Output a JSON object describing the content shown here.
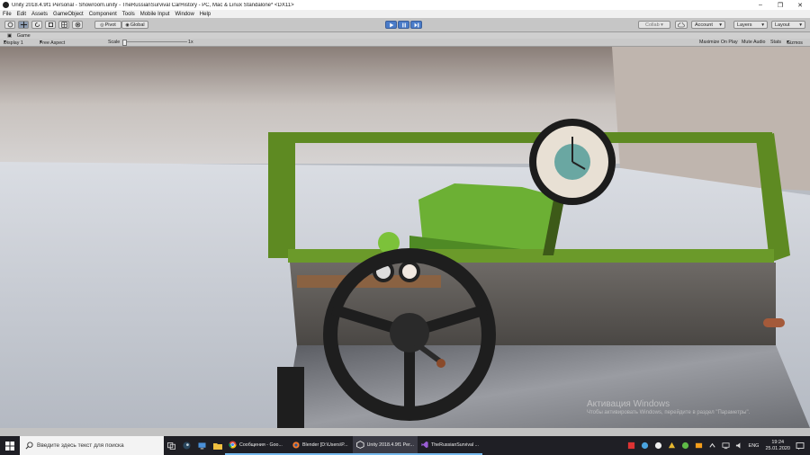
{
  "window": {
    "title": "Unity 2018.4.9f1 Personal - Showroom.unity - TheRussianSurvival CarHistory - PC, Mac & Linux Standalone* <DX11>"
  },
  "menu": [
    "File",
    "Edit",
    "Assets",
    "GameObject",
    "Component",
    "Tools",
    "Mobile Input",
    "Window",
    "Help"
  ],
  "toolbar": {
    "pivot": "Pivot",
    "global": "Global",
    "collab": "Collab ▾",
    "account": "Account",
    "layers": "Layers",
    "layout": "Layout"
  },
  "game_tab": "Game",
  "game_options": {
    "display": "Display 1",
    "aspect": "Free Aspect",
    "scale_label": "Scale",
    "scale_value": "1x",
    "maximize": "Maximize On Play",
    "mute": "Mute Audio",
    "stats": "Stats",
    "gizmos": "Gizmos"
  },
  "watermark": {
    "line1": "Активация Windows",
    "line2": "Чтобы активировать Windows, перейдите в раздел \"Параметры\"."
  },
  "taskbar": {
    "search_placeholder": "Введите здесь текст для поиска",
    "apps": [
      {
        "label": "Сообщения - Goo..."
      },
      {
        "label": "Blender [D:\\Users\\P..."
      },
      {
        "label": "Unity 2018.4.9f1 Per..."
      },
      {
        "label": "TheRussianSurvival ..."
      }
    ],
    "lang": "ENG",
    "time": "19:24",
    "date": "25.01.2020"
  },
  "colors": {
    "frame_green": "#5e8a22",
    "hood_green": "#6cb034",
    "play_blue": "#4a7cc9",
    "taskbar": "#1f1f25"
  }
}
